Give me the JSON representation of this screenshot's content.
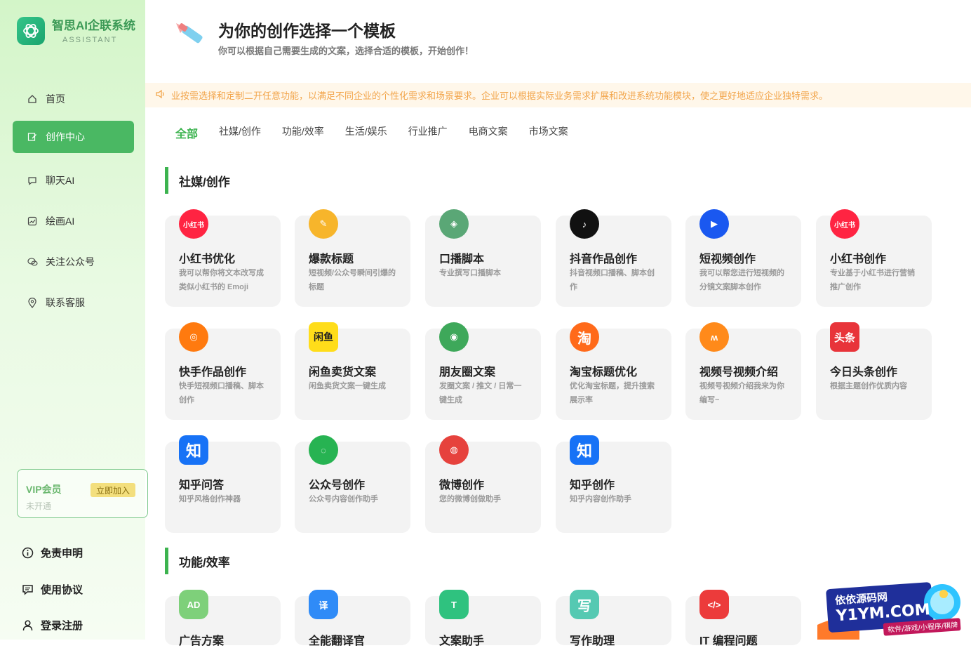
{
  "app": {
    "title": "智思AI企联系统",
    "subtitle": "ASSISTANT"
  },
  "sidebar": {
    "items": [
      {
        "label": "首页",
        "icon": "home-icon"
      },
      {
        "label": "创作中心",
        "icon": "edit-icon",
        "active": true
      },
      {
        "label": "聊天AI",
        "icon": "chat-icon"
      },
      {
        "label": "绘画AI",
        "icon": "image-icon"
      },
      {
        "label": "关注公众号",
        "icon": "wechat-icon"
      },
      {
        "label": "联系客服",
        "icon": "location-icon"
      }
    ],
    "vip": {
      "title": "VIP会员",
      "status": "未开通",
      "button": "立即加入"
    },
    "bottom": [
      {
        "label": "免责申明",
        "icon": "info-icon"
      },
      {
        "label": "使用协议",
        "icon": "agreement-icon"
      },
      {
        "label": "登录注册",
        "icon": "user-icon"
      }
    ]
  },
  "header": {
    "title": "为你的创作选择一个模板",
    "subtitle": "你可以根据自己需要生成的文案，选择合适的模板，开始创作！"
  },
  "notice": "业按需选择和定制二开任意功能，以满足不同企业的个性化需求和场景要求。企业可以根据实际业务需求扩展和改进系统功能模块，使之更好地适应企业独特需求。",
  "tabs": [
    "全部",
    "社媒/创作",
    "功能/效率",
    "生活/娱乐",
    "行业推广",
    "电商文案",
    "市场文案"
  ],
  "sections": [
    {
      "title": "社媒/创作",
      "cards": [
        {
          "title": "小红书优化",
          "desc": "我可以帮你将文本改写成类似小红书的 Emoji",
          "icon": "小红书",
          "color": "#ff2442"
        },
        {
          "title": "爆款标题",
          "desc": "短视频/公众号瞬间引爆的标题",
          "icon": "✎",
          "color": "#f7b52b"
        },
        {
          "title": "口播脚本",
          "desc": "专业撰写口播脚本",
          "icon": "◈",
          "color": "#5aa776"
        },
        {
          "title": "抖音作品创作",
          "desc": "抖音视频口播稿、脚本创作",
          "icon": "♪",
          "color": "#111111"
        },
        {
          "title": "短视频创作",
          "desc": "我可以帮您进行短视频的分镜文案脚本创作",
          "icon": "▶",
          "color": "#1a58f0"
        },
        {
          "title": "小红书创作",
          "desc": "专业基于小红书进行营销推广创作",
          "icon": "小红书",
          "color": "#ff2442"
        },
        {
          "title": "快手作品创作",
          "desc": "快手短视频口播稿、脚本创作",
          "icon": "◎",
          "color": "#ff7a0f"
        },
        {
          "title": "闲鱼卖货文案",
          "desc": "闲鱼卖货文案一键生成",
          "icon": "闲鱼",
          "color": "#ffdd1a"
        },
        {
          "title": "朋友圈文案",
          "desc": "发圈文案 / 推文 / 日常一键生成",
          "icon": "◉",
          "color": "#3ea85a"
        },
        {
          "title": "淘宝标题优化",
          "desc": "优化淘宝标题，提升搜索展示率",
          "icon": "淘",
          "color": "#ff6a1a"
        },
        {
          "title": "视频号视频介绍",
          "desc": "视频号视频介绍我来为你编写~",
          "icon": "ʍ",
          "color": "#ff8a1a"
        },
        {
          "title": "今日头条创作",
          "desc": "根据主题创作优质内容",
          "icon": "头条",
          "color": "#e8343a"
        },
        {
          "title": "知乎问答",
          "desc": "知乎风格创作神器",
          "icon": "知",
          "color": "#1772f6"
        },
        {
          "title": "公众号创作",
          "desc": "公众号内容创作助手",
          "icon": "◌",
          "color": "#27b352"
        },
        {
          "title": "微博创作",
          "desc": "您的微博创做助手",
          "icon": "◍",
          "color": "#e6423d"
        },
        {
          "title": "知乎创作",
          "desc": "知乎内容创作助手",
          "icon": "知",
          "color": "#1772f6"
        }
      ]
    },
    {
      "title": "功能/效率",
      "cards": [
        {
          "title": "广告方案",
          "desc": "",
          "icon": "AD",
          "color": "#7ed07a"
        },
        {
          "title": "全能翻译官",
          "desc": "",
          "icon": "译",
          "color": "#2f8bf7"
        },
        {
          "title": "文案助手",
          "desc": "",
          "icon": "T",
          "color": "#2fc27f"
        },
        {
          "title": "写作助理",
          "desc": "",
          "icon": "写",
          "color": "#55c9b2"
        },
        {
          "title": "IT 编程问题",
          "desc": "",
          "icon": "</>",
          "color": "#ec3b3b"
        }
      ]
    }
  ],
  "badge": {
    "line1": "依依源码网",
    "line2": "Y1YM.COM",
    "line3": "软件/游戏/小程序/棋牌"
  },
  "colors": {
    "accent": "#3cb34f",
    "sidebar_bg": "#dcf6d2",
    "notice_text": "#f2a54b"
  }
}
